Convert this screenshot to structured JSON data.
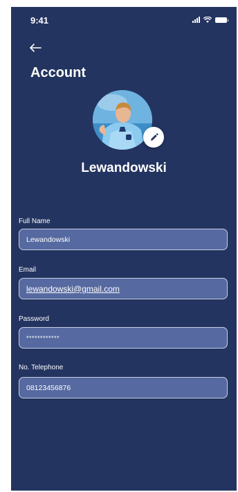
{
  "status_bar": {
    "time": "9:41",
    "icons": [
      "signal-icon",
      "wifi-icon",
      "battery-icon"
    ]
  },
  "header": {
    "back_icon": "arrow-left-icon",
    "title": "Account"
  },
  "profile": {
    "name": "Lewandowski",
    "edit_icon": "pencil-icon"
  },
  "form": {
    "full_name": {
      "label": "Full Name",
      "value": "Lewandowski"
    },
    "email": {
      "label": "Email",
      "value": "lewandowski@gmail.com"
    },
    "password": {
      "label": "Password",
      "value": "************"
    },
    "telephone": {
      "label": "No. Telephone",
      "value": "08123456876"
    }
  },
  "colors": {
    "background": "#243460",
    "input_fill": "#5669a0",
    "input_border": "#c5cee4",
    "text": "#ffffff"
  }
}
